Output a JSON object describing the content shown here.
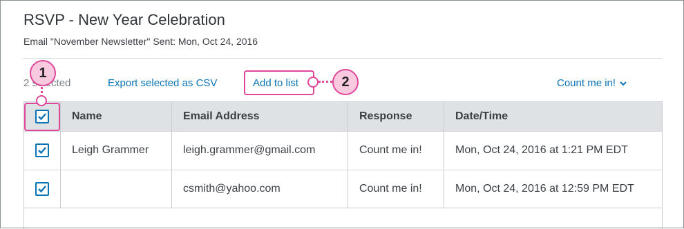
{
  "header": {
    "title": "RSVP - New Year Celebration",
    "subtitle": "Email \"November Newsletter\" Sent: Mon, Oct 24, 2016"
  },
  "toolbar": {
    "selected_count": "2 selected",
    "export_label": "Export selected as CSV",
    "add_to_list_label": "Add to list",
    "response_filter": "Count me in!"
  },
  "table": {
    "columns": [
      "Name",
      "Email Address",
      "Response",
      "Date/Time"
    ],
    "rows": [
      {
        "checked": true,
        "name": "Leigh Grammer",
        "email": "leigh.grammer@gmail.com",
        "response": "Count me in!",
        "datetime": "Mon, Oct 24, 2016 at 1:21 PM EDT"
      },
      {
        "checked": true,
        "name": "",
        "email": "csmith@yahoo.com",
        "response": "Count me in!",
        "datetime": "Mon, Oct 24, 2016 at 12:59 PM EDT"
      }
    ]
  },
  "annotations": {
    "callout_1": "1",
    "callout_2": "2"
  },
  "colors": {
    "accent": "#0a73b5",
    "annotation": "#e0479b",
    "header_bg": "#dfe2e5"
  }
}
